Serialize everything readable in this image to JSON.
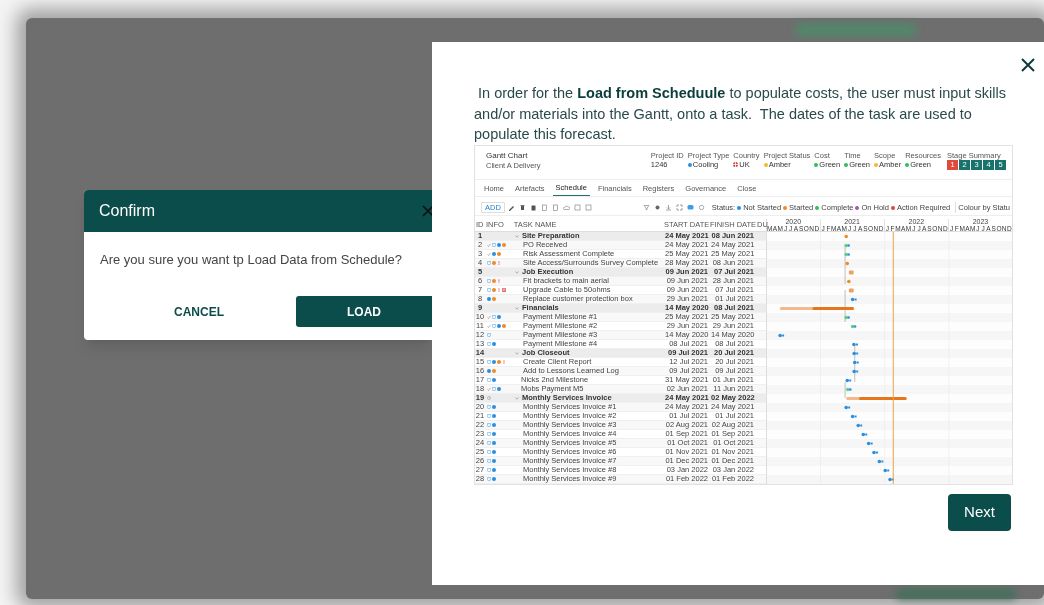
{
  "confirm_dialog": {
    "title": "Confirm",
    "message": "Are you sure you want tp Load Data from Schedule?",
    "buttons": [
      {
        "label": "CANCEL",
        "kind": "text"
      },
      {
        "label": "LOAD",
        "kind": "primary"
      }
    ]
  },
  "tutorial": {
    "text": " In order for the **Load from Scheduule** to populate costs, the user must input skills and/or materials into the Gantt, onto a task.  The dates of the task are used to populate this forecast.",
    "screenshot": {
      "title": "Gantt Chart",
      "subtitle": "Client A Delivery",
      "fields": [
        {
          "label": "Project ID",
          "value": "1246",
          "kind": "text"
        },
        {
          "label": "Project Type",
          "value": "Cooling",
          "kind": "dot",
          "color": "#2b8ee0"
        },
        {
          "label": "Country",
          "value": "UK",
          "kind": "flag"
        },
        {
          "label": "Project Status",
          "value": "Amber",
          "kind": "dot",
          "color": "#f5b82e"
        },
        {
          "label": "Cost",
          "value": "Green",
          "kind": "dot",
          "color": "#2fbf5b"
        },
        {
          "label": "Time",
          "value": "Green",
          "kind": "dot",
          "color": "#2fbf5b"
        },
        {
          "label": "Scope",
          "value": "Amber",
          "kind": "dot",
          "color": "#f5b82e"
        },
        {
          "label": "Resources",
          "value": "Green",
          "kind": "dot",
          "color": "#2fbf5b"
        }
      ],
      "stage_summary": {
        "label": "Stage Summary",
        "stages": [
          {
            "label": "1",
            "color": "#e04a3c"
          },
          {
            "label": "2",
            "color": "#17736b"
          },
          {
            "label": "3",
            "color": "#17736b"
          },
          {
            "label": "4",
            "color": "#17736b"
          },
          {
            "label": "5",
            "color": "#17736b"
          }
        ]
      },
      "tabs": [
        {
          "label": "Home",
          "selected": false
        },
        {
          "label": "Artefacts",
          "selected": false
        },
        {
          "label": "Schedule",
          "selected": true
        },
        {
          "label": "Financials",
          "selected": false
        },
        {
          "label": "Registers",
          "selected": false
        },
        {
          "label": "Governance",
          "selected": false
        },
        {
          "label": "Close",
          "selected": false
        }
      ],
      "add_button": "ADD",
      "legend": {
        "label": "Status:",
        "items": [
          {
            "label": "Not Started",
            "color": "#2b8ee0"
          },
          {
            "label": "Started",
            "color": "#f08a24"
          },
          {
            "label": "Complete",
            "color": "#2fbf5b"
          },
          {
            "label": "On Hold",
            "color": "#9b59b6"
          },
          {
            "label": "Action Required",
            "color": "#e0463b"
          }
        ]
      },
      "colour_by": "Colour by Statu",
      "columns": [
        "ID",
        "INFO",
        "TASK NAME",
        "START DATE",
        "FINISH DATE",
        "DU"
      ],
      "timeline": [
        {
          "year": "2020",
          "months": [
            "M",
            "A",
            "M",
            "J",
            "J",
            "A",
            "S",
            "O",
            "N",
            "D"
          ]
        },
        {
          "year": "2021",
          "months": [
            "J",
            "F",
            "M",
            "A",
            "M",
            "J",
            "J",
            "A",
            "S",
            "O",
            "N",
            "D"
          ]
        },
        {
          "year": "2022",
          "months": [
            "J",
            "F",
            "M",
            "A",
            "M",
            "J",
            "J",
            "A",
            "S",
            "O",
            "N",
            "D"
          ]
        },
        {
          "year": "2023",
          "months": [
            "J",
            "F",
            "M",
            "A",
            "M",
            "J",
            "J",
            "A",
            "S",
            "O",
            "N",
            "D"
          ]
        }
      ],
      "rows": [
        {
          "id": "1",
          "name": "Site Preparation",
          "start": "24 May 2021",
          "finish": "08 Jun 2021",
          "expanded": true,
          "children": [
            {
              "id": "2",
              "name": "PO Received",
              "start": "24 May 2021",
              "finish": "24 May 2021",
              "info": [
                {
                  "kind": "check"
                },
                {
                  "kind": "doc"
                },
                {
                  "kind": "dot",
                  "color": "#2b8ee0"
                },
                {
                  "kind": "dot",
                  "color": "#f08a24"
                }
              ]
            },
            {
              "id": "3",
              "name": "Risk Assessment Complete",
              "start": "25 May 2021",
              "finish": "25 May 2021",
              "info": [
                {
                  "kind": "check"
                },
                {
                  "kind": "dot",
                  "color": "#2b8ee0"
                },
                {
                  "kind": "dot",
                  "color": "#f08a24"
                }
              ]
            },
            {
              "id": "4",
              "name": "Site Access/Surrounds Survey Complete",
              "start": "28 May 2021",
              "finish": "08 Jun 2021",
              "info": [
                {
                  "kind": "doc"
                },
                {
                  "kind": "dot",
                  "color": "#f08a24"
                },
                {
                  "kind": "alert"
                }
              ]
            }
          ]
        },
        {
          "id": "5",
          "name": "Job Execution",
          "start": "09 Jun 2021",
          "finish": "07 Jul 2021",
          "expanded": true,
          "children": [
            {
              "id": "6",
              "name": "Fit brackets to main aerial",
              "start": "09 Jun 2021",
              "finish": "28 Jun 2021",
              "info": [
                {
                  "kind": "doc"
                },
                {
                  "kind": "dot",
                  "color": "#f08a24"
                },
                {
                  "kind": "alert"
                }
              ]
            },
            {
              "id": "7",
              "name": "Upgrade Cable to 50ohms",
              "start": "09 Jun 2021",
              "finish": "07 Jul 2021",
              "info": [
                {
                  "kind": "doc"
                },
                {
                  "kind": "dot",
                  "color": "#f08a24"
                },
                {
                  "kind": "alert"
                },
                {
                  "kind": "flag"
                }
              ]
            },
            {
              "id": "8",
              "name": "Replace customer protection box",
              "start": "29 Jun 2021",
              "finish": "01 Jul 2021",
              "info": [
                {
                  "kind": "dot",
                  "color": "#2b8ee0"
                },
                {
                  "kind": "dot",
                  "color": "#f08a24"
                }
              ]
            }
          ]
        },
        {
          "id": "9",
          "name": "Financials",
          "start": "14 May 2020",
          "finish": "08 Jul 2021",
          "expanded": true,
          "children": [
            {
              "id": "10",
              "name": "Payment Milestone #1",
              "start": "25 May 2021",
              "finish": "25 May 2021",
              "info": [
                {
                  "kind": "check"
                },
                {
                  "kind": "doc"
                },
                {
                  "kind": "dot",
                  "color": "#2b8ee0"
                }
              ]
            },
            {
              "id": "11",
              "name": "Payment Milestone #2",
              "start": "29 Jun 2021",
              "finish": "29 Jun 2021",
              "info": [
                {
                  "kind": "check"
                },
                {
                  "kind": "doc"
                },
                {
                  "kind": "dot",
                  "color": "#2b8ee0"
                },
                {
                  "kind": "dot",
                  "color": "#f08a24"
                }
              ]
            },
            {
              "id": "12",
              "name": "Payment Milestone #3",
              "start": "14 May 2020",
              "finish": "14 May 2020",
              "info": [
                {
                  "kind": "doc"
                }
              ]
            },
            {
              "id": "13",
              "name": "Payment Milestone #4",
              "start": "08 Jul 2021",
              "finish": "08 Jul 2021",
              "info": [
                {
                  "kind": "doc"
                },
                {
                  "kind": "dot",
                  "color": "#2b8ee0"
                }
              ]
            }
          ]
        },
        {
          "id": "14",
          "name": "Job Closeout",
          "start": "09 Jul 2021",
          "finish": "20 Jul 2021",
          "expanded": true,
          "children": [
            {
              "id": "15",
              "name": "Create Client Report",
              "start": "12 Jul 2021",
              "finish": "20 Jul 2021",
              "info": [
                {
                  "kind": "doc"
                },
                {
                  "kind": "dot",
                  "color": "#2b8ee0"
                },
                {
                  "kind": "dot",
                  "color": "#f08a24"
                },
                {
                  "kind": "alert"
                }
              ]
            },
            {
              "id": "16",
              "name": "Add to Lessons Learned Log",
              "start": "09 Jul 2021",
              "finish": "09 Jul 2021",
              "info": [
                {
                  "kind": "dot",
                  "color": "#2b8ee0"
                },
                {
                  "kind": "dot",
                  "color": "#f08a24"
                }
              ]
            }
          ]
        },
        {
          "id": "17",
          "name": "Nicks 2nd Milestone",
          "start": "31 May 2021",
          "finish": "01 Jun 2021",
          "info": [
            {
              "kind": "doc"
            },
            {
              "kind": "dot",
              "color": "#2b8ee0"
            }
          ]
        },
        {
          "id": "18",
          "name": "Mobs Payment M5",
          "start": "02 Jun 2021",
          "finish": "11 Jun 2021",
          "info": [
            {
              "kind": "check"
            },
            {
              "kind": "doc"
            },
            {
              "kind": "dot",
              "color": "#2b8ee0"
            }
          ]
        },
        {
          "id": "19",
          "name": "Monthly Services Invoice",
          "start": "24 May 2021",
          "finish": "02 May 2022",
          "expanded": true,
          "info": [
            {
              "kind": "clock"
            }
          ],
          "children": [
            {
              "id": "20",
              "name": "Monthly Services Invoice #1",
              "start": "24 May 2021",
              "finish": "24 May 2021",
              "info": [
                {
                  "kind": "doc"
                },
                {
                  "kind": "dot",
                  "color": "#2b8ee0"
                }
              ]
            },
            {
              "id": "21",
              "name": "Monthly Services Invoice #2",
              "start": "01 Jul 2021",
              "finish": "01 Jul 2021",
              "info": [
                {
                  "kind": "doc"
                },
                {
                  "kind": "dot",
                  "color": "#2b8ee0"
                }
              ]
            },
            {
              "id": "22",
              "name": "Monthly Services Invoice #3",
              "start": "02 Aug 2021",
              "finish": "02 Aug 2021",
              "info": [
                {
                  "kind": "doc"
                },
                {
                  "kind": "dot",
                  "color": "#2b8ee0"
                }
              ]
            },
            {
              "id": "23",
              "name": "Monthly Services Invoice #4",
              "start": "01 Sep 2021",
              "finish": "01 Sep 2021",
              "info": [
                {
                  "kind": "doc"
                },
                {
                  "kind": "dot",
                  "color": "#2b8ee0"
                }
              ]
            },
            {
              "id": "24",
              "name": "Monthly Services Invoice #5",
              "start": "01 Oct 2021",
              "finish": "01 Oct 2021",
              "info": [
                {
                  "kind": "doc"
                },
                {
                  "kind": "dot",
                  "color": "#2b8ee0"
                }
              ]
            },
            {
              "id": "25",
              "name": "Monthly Services Invoice #6",
              "start": "01 Nov 2021",
              "finish": "01 Nov 2021",
              "info": [
                {
                  "kind": "doc"
                },
                {
                  "kind": "dot",
                  "color": "#2b8ee0"
                }
              ]
            },
            {
              "id": "26",
              "name": "Monthly Services Invoice #7",
              "start": "01 Dec 2021",
              "finish": "01 Dec 2021",
              "info": [
                {
                  "kind": "doc"
                },
                {
                  "kind": "dot",
                  "color": "#2b8ee0"
                }
              ]
            },
            {
              "id": "27",
              "name": "Monthly Services Invoice #8",
              "start": "03 Jan 2022",
              "finish": "03 Jan 2022",
              "info": [
                {
                  "kind": "doc"
                },
                {
                  "kind": "dot",
                  "color": "#2b8ee0"
                }
              ]
            },
            {
              "id": "28",
              "name": "Monthly Services Invoice #9",
              "start": "01 Feb 2022",
              "finish": "01 Feb 2022",
              "info": [
                {
                  "kind": "doc"
                },
                {
                  "kind": "dot",
                  "color": "#2b8ee0"
                }
              ]
            }
          ]
        }
      ]
    },
    "next_button": "Next"
  }
}
